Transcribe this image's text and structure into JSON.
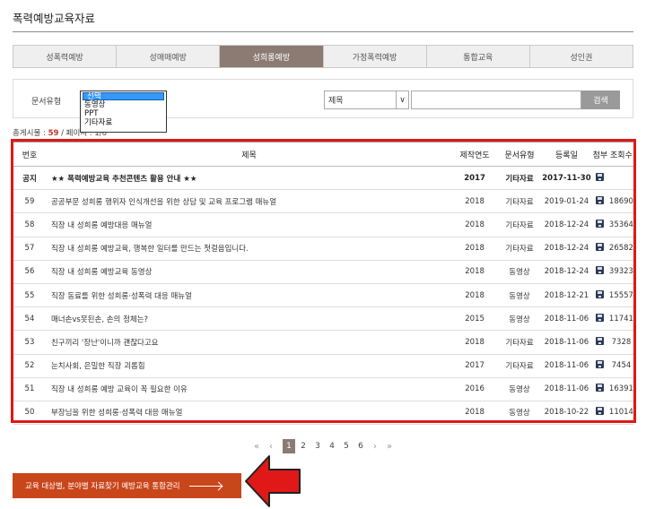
{
  "page_title": "폭력예방교육자료",
  "tabs": [
    {
      "label": "성폭력예방",
      "active": false
    },
    {
      "label": "성매매예방",
      "active": false
    },
    {
      "label": "성희롱예방",
      "active": true
    },
    {
      "label": "가정폭력예방",
      "active": false
    },
    {
      "label": "통합교육",
      "active": false
    },
    {
      "label": "성인권",
      "active": false
    }
  ],
  "search": {
    "doc_type_label": "문서유형",
    "doc_type_options": [
      "선택",
      "동영상",
      "PPT",
      "기타자료"
    ],
    "doc_type_selected": "선택",
    "field_select_value": "제목",
    "field_select_arrow": "∨",
    "query_value": "",
    "button_label": "검색"
  },
  "count_line": {
    "prefix": "총게시물 : ",
    "total": "59",
    "suffix": " / 페이지 : 1/6"
  },
  "table": {
    "headers": [
      "번호",
      "제목",
      "제작연도",
      "문서유형",
      "등록일",
      "첨부",
      "조회수"
    ],
    "rows": [
      {
        "no": "공지",
        "title": "★★ 폭력예방교육 추천콘텐츠 활용 안내 ★★",
        "year": "2017",
        "type": "기타자료",
        "date": "2017-11-30",
        "attach": true,
        "views": "",
        "notice": true
      },
      {
        "no": "59",
        "title": "공공부문 성희롱 행위자 인식개선을 위한 상담 및 교육 프로그램 매뉴얼",
        "year": "2018",
        "type": "기타자료",
        "date": "2019-01-24",
        "attach": true,
        "views": "18690"
      },
      {
        "no": "58",
        "title": "직장 내 성희롱 예방대응 매뉴얼",
        "year": "2018",
        "type": "기타자료",
        "date": "2018-12-24",
        "attach": true,
        "views": "35364"
      },
      {
        "no": "57",
        "title": "직장 내 성희롱 예방교육, 행복한 일터를 만드는 첫걸음입니다.",
        "year": "2018",
        "type": "기타자료",
        "date": "2018-12-24",
        "attach": true,
        "views": "26582"
      },
      {
        "no": "56",
        "title": "직장 내 성희롱 예방교육 동영상",
        "year": "2018",
        "type": "동영상",
        "date": "2018-12-24",
        "attach": true,
        "views": "39323"
      },
      {
        "no": "55",
        "title": "직장 동료를 위한 성희롱·성폭력 대응 매뉴얼",
        "year": "2018",
        "type": "동영상",
        "date": "2018-12-21",
        "attach": true,
        "views": "15557"
      },
      {
        "no": "54",
        "title": "매너손vs못된손, 손의 정체는?",
        "year": "2015",
        "type": "동영상",
        "date": "2018-11-06",
        "attach": true,
        "views": "11741"
      },
      {
        "no": "53",
        "title": "친구끼리 '장난'이니까 괜찮다고요",
        "year": "2018",
        "type": "기타자료",
        "date": "2018-11-06",
        "attach": true,
        "views": "7328"
      },
      {
        "no": "52",
        "title": "눈치사회, 은밀한 직장 괴롭힘",
        "year": "2017",
        "type": "기타자료",
        "date": "2018-11-06",
        "attach": true,
        "views": "7454"
      },
      {
        "no": "51",
        "title": "직장 내 성희롱 예방 교육이 꼭 필요한 이유",
        "year": "2016",
        "type": "동영상",
        "date": "2018-11-06",
        "attach": true,
        "views": "16391"
      },
      {
        "no": "50",
        "title": "부장님을 위한 성희롱·성폭력 대응 매뉴얼",
        "year": "2018",
        "type": "동영상",
        "date": "2018-10-22",
        "attach": true,
        "views": "11014"
      }
    ]
  },
  "pagination": {
    "first": "«",
    "prev": "‹",
    "pages": [
      "1",
      "2",
      "3",
      "4",
      "5",
      "6"
    ],
    "current": "1",
    "next": "›",
    "last": "»"
  },
  "bottom_button": {
    "label": "교육 대상별, 분야별 자료찾기 예방교육 통합관리"
  },
  "colors": {
    "accent": "#8b7b73",
    "highlight_border": "#e01818",
    "orange_button": "#c9461b"
  }
}
